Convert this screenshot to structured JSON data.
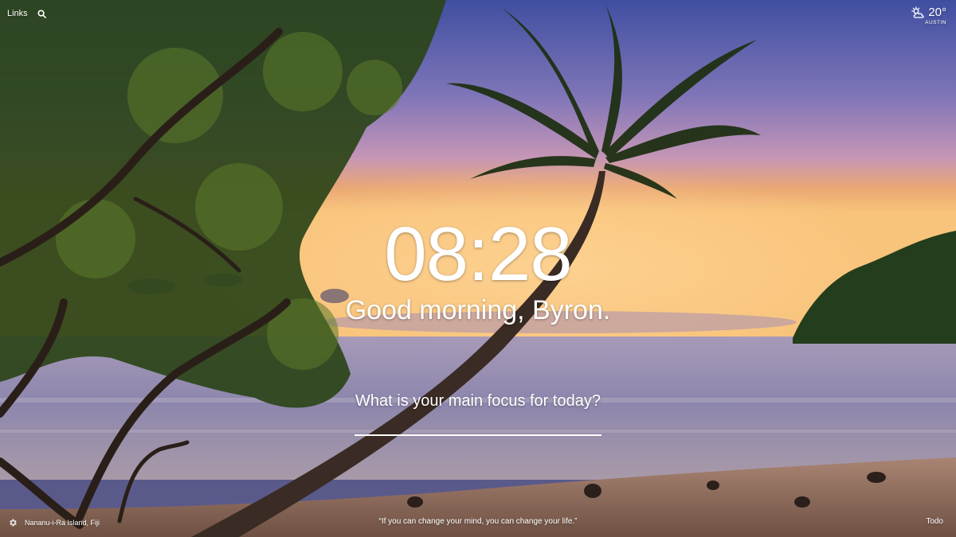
{
  "top_left": {
    "links_label": "Links",
    "search_icon": "search-icon"
  },
  "weather": {
    "icon": "partly-cloudy-sun-icon",
    "temperature": "20°",
    "location": "AUSTIN"
  },
  "center": {
    "clock": "08:28",
    "greeting": "Good morning, Byron.",
    "focus_question": "What is your main focus for today?",
    "focus_input_value": ""
  },
  "bottom": {
    "settings_icon": "gear-icon",
    "photo_location": "Nananu-i-Ra Island, Fiji",
    "quote": "“If you can change your mind, you can change your life.”",
    "todo_label": "Todo"
  },
  "colors": {
    "sky_top": "#4a59a8",
    "sky_mid": "#b98fc0",
    "horizon": "#f3a961",
    "sea": "#8f8ab0",
    "sand": "#9b7564",
    "foliage": "#2f4a1a",
    "text": "#ffffff"
  }
}
